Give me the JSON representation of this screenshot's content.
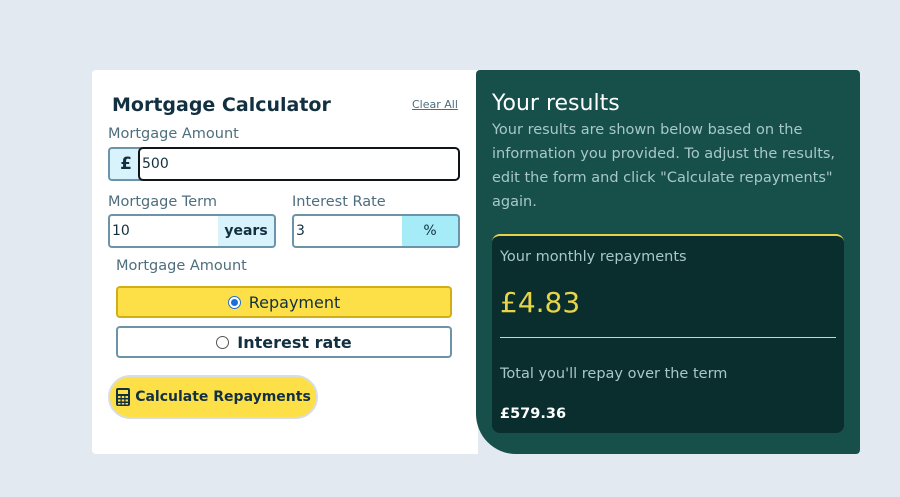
{
  "form": {
    "title": "Mortgage Calculator",
    "clear_all": "Clear All",
    "amount": {
      "label": "Mortgage Amount",
      "prefix": "£",
      "value": "500"
    },
    "term": {
      "label": "Mortgage Term",
      "value": "10",
      "suffix": "years"
    },
    "rate": {
      "label": "Interest Rate",
      "value": "3",
      "suffix": "%"
    },
    "type": {
      "label": "Mortgage Amount",
      "options": [
        {
          "label": "Repayment",
          "selected": true
        },
        {
          "label": "Interest rate",
          "selected": false
        }
      ]
    },
    "calculate_button": "Calculate Repayments"
  },
  "results": {
    "title": "Your results",
    "description": "Your results are shown below based on the information you provided. To adjust the results, edit the form and click \"Calculate repayments\" again.",
    "monthly_label": "Your monthly repayments",
    "monthly_value": "£4.83",
    "total_label": "Total you'll repay over the term",
    "total_value": "£579.36"
  },
  "colors": {
    "background": "#e3e9f1",
    "results_panel": "#17504b",
    "summary_box": "#0a2d2e",
    "accent_yellow": "#fde047",
    "accent_cyan": "#d8f3fc"
  },
  "icons": {
    "calculate_button": "calculator-icon"
  }
}
